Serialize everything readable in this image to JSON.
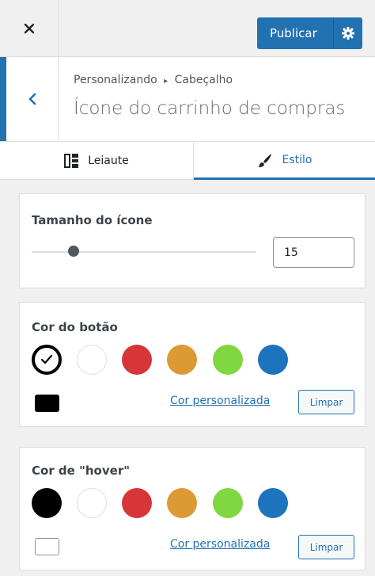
{
  "topbar": {
    "close_icon": "close-icon",
    "publish_label": "Publicar",
    "publish_settings_icon": "gear-icon"
  },
  "section": {
    "back_icon": "chevron-left-icon",
    "breadcrumb_parent": "Personalizando",
    "breadcrumb_separator": "▸",
    "breadcrumb_current": "Cabeçalho",
    "title": "Ícone do carrinho de compras"
  },
  "tabs": [
    {
      "label": "Leiaute",
      "icon": "layout-icon",
      "active": false
    },
    {
      "label": "Estilo",
      "icon": "brush-icon",
      "active": true
    }
  ],
  "icon_size": {
    "title": "Tamanho do ícone",
    "value": "15",
    "slider_value": 15
  },
  "button_color": {
    "title": "Cor do botão",
    "swatches": [
      "#000000",
      "#ffffff",
      "#d63638",
      "#dd9933",
      "#81d742",
      "#1e73be"
    ],
    "selected_index": 0,
    "current_color": "#000000",
    "custom_link": "Cor personalizada",
    "clear_label": "Limpar"
  },
  "hover_color": {
    "title": "Cor de \"hover\"",
    "swatches": [
      "#000000",
      "#ffffff",
      "#d63638",
      "#dd9933",
      "#81d742",
      "#1e73be"
    ],
    "current_color": "#ffffff",
    "custom_link": "Cor personalizada",
    "clear_label": "Limpar"
  },
  "colors": {
    "accent": "#2271b1"
  }
}
